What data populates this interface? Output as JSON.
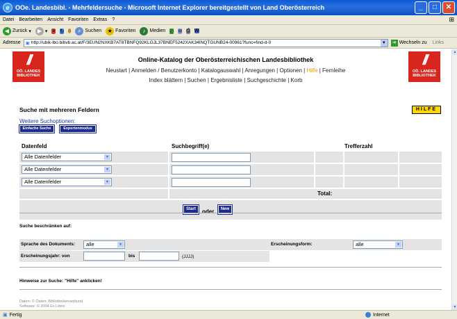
{
  "window": {
    "title": "OOe. Landesbibl. - Mehrfeldersuche - Microsoft Internet Explorer bereitgestellt von Land Oberösterreich",
    "minimize": "_",
    "maximize": "□",
    "close": "✕"
  },
  "menu": [
    "Datei",
    "Bearbeiten",
    "Ansicht",
    "Favoriten",
    "Extras",
    "?"
  ],
  "toolbar": {
    "back": "Zurück",
    "search": "Suchen",
    "favorites": "Favoriten",
    "media": "Medien"
  },
  "address": {
    "label": "Adresse",
    "url": "http://ubik-lbo.bibvb.ac.at/F/3EUN2NXKB7AT8TBNFQ92KLGJL37BNEF5242XAK34INQTGUNB24-00961?func=find-d-0",
    "go": "Wechseln zu",
    "links": "Links"
  },
  "page": {
    "logo_text": "OÖ. LANDES BIBLIOTHEK",
    "catalog_title": "Online-Katalog der Oberösterreichischen Landesbibliothek",
    "nav1_pre": "Neustart | Anmelden / Benutzerkonto | Katalogauswahl | Anregungen | Optionen |",
    "nav1_hilfe": "Hilfe",
    "nav1_post": "| Fernleihe",
    "nav2": "Index blättern | Suchen | Ergebnisliste | Suchgeschichte | Korb",
    "heading": "Suche mit mehreren Feldern",
    "more_options": "Weitere Suchoptionen:",
    "btn_simple": "Einfache Suche",
    "btn_expert": "Expertenmodus",
    "btn_help": "HILFE",
    "col_field": "Datenfeld",
    "col_term": "Suchbegriff(e)",
    "col_hits": "Trefferzahl",
    "rows": [
      {
        "field": "Alle Datenfelder",
        "term": ""
      },
      {
        "field": "Alle Datenfelder",
        "term": ""
      },
      {
        "field": "Alle Datenfelder",
        "term": ""
      }
    ],
    "total": "Total:",
    "btn_start": "Start",
    "or": "oder",
    "btn_new": "New",
    "restrict_heading": "Suche beschränken auf:",
    "lang_label": "Sprache des Dokuments:",
    "lang_value": "alle",
    "form_label": "Erscheinungsform:",
    "form_value": "alle",
    "year_label": "Erscheinungsjahr:  von",
    "year_to": "bis",
    "year_format": "(JJJJ)",
    "hint": "Hinweise zur Suche: \"Hilfe\" anklicken!",
    "footer1": "Daten: © Österr. Bibliothekenverbund",
    "footer2": "Software: © 2004 Ex Libris"
  },
  "status": {
    "left": "Fertig",
    "zone": "Internet"
  }
}
